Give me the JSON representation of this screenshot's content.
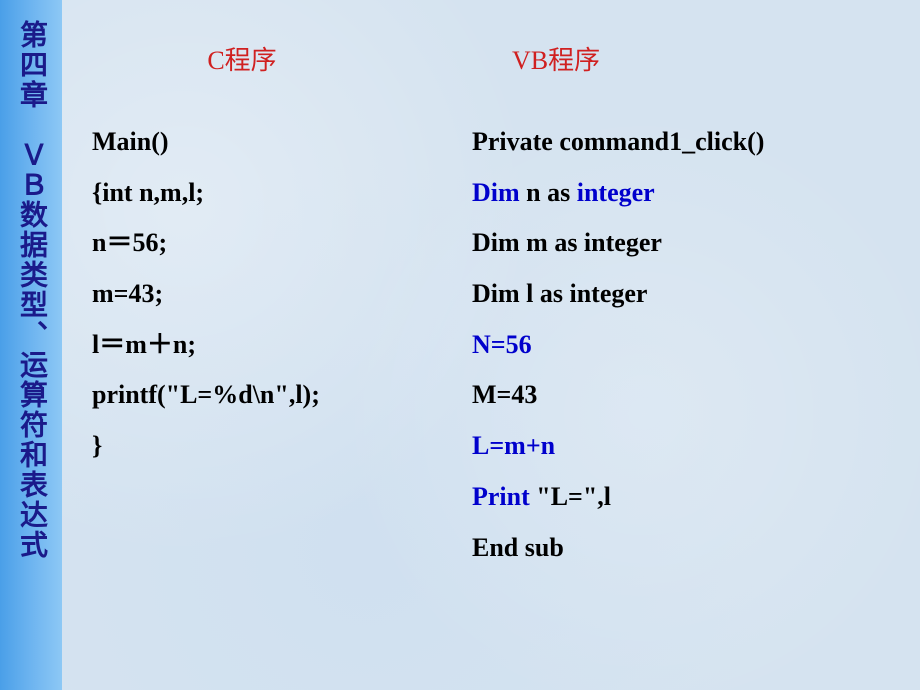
{
  "sidebar": {
    "title": "第四章　ＶＢ数据类型、运算符和表达式"
  },
  "columns": {
    "left": {
      "title": "C程序",
      "lines": [
        "Main()",
        "{int    n,m,l;",
        "n＝56;",
        "m=43;",
        "l＝m＋n;",
        "printf(\"L=%d\\n\",l);",
        "}"
      ]
    },
    "right": {
      "title": "VB程序",
      "lines": {
        "l1": "Private  command1_click()",
        "l2a": "Dim",
        "l2b": " n as ",
        "l2c": "integer",
        "l3": "Dim m as integer",
        "l4": "Dim l as integer",
        "l5": "N=56",
        "l6": "M=43",
        "l7": "L=m+n",
        "l8a": "Print",
        "l8b": " \"L=\",l",
        "l9": "End sub"
      }
    }
  }
}
